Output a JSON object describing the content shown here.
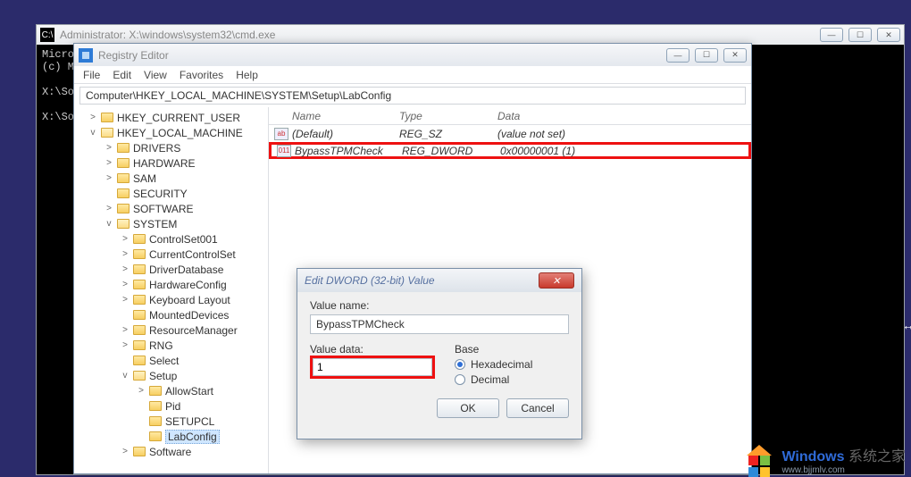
{
  "cmd": {
    "title": "Administrator: X:\\windows\\system32\\cmd.exe",
    "lines": "Micro\n(c) M\n\nX:\\So\n\nX:\\So"
  },
  "regedit": {
    "title": "Registry Editor",
    "menu": [
      "File",
      "Edit",
      "View",
      "Favorites",
      "Help"
    ],
    "path": "Computer\\HKEY_LOCAL_MACHINE\\SYSTEM\\Setup\\LabConfig",
    "tree": [
      {
        "depth": 0,
        "tw": ">",
        "open": false,
        "label": "HKEY_CURRENT_USER"
      },
      {
        "depth": 0,
        "tw": "v",
        "open": true,
        "label": "HKEY_LOCAL_MACHINE"
      },
      {
        "depth": 1,
        "tw": ">",
        "open": false,
        "label": "DRIVERS"
      },
      {
        "depth": 1,
        "tw": ">",
        "open": false,
        "label": "HARDWARE"
      },
      {
        "depth": 1,
        "tw": ">",
        "open": false,
        "label": "SAM"
      },
      {
        "depth": 1,
        "tw": "",
        "open": false,
        "label": "SECURITY"
      },
      {
        "depth": 1,
        "tw": ">",
        "open": false,
        "label": "SOFTWARE"
      },
      {
        "depth": 1,
        "tw": "v",
        "open": true,
        "label": "SYSTEM"
      },
      {
        "depth": 2,
        "tw": ">",
        "open": false,
        "label": "ControlSet001"
      },
      {
        "depth": 2,
        "tw": ">",
        "open": false,
        "label": "CurrentControlSet"
      },
      {
        "depth": 2,
        "tw": ">",
        "open": false,
        "label": "DriverDatabase"
      },
      {
        "depth": 2,
        "tw": ">",
        "open": false,
        "label": "HardwareConfig"
      },
      {
        "depth": 2,
        "tw": ">",
        "open": false,
        "label": "Keyboard Layout"
      },
      {
        "depth": 2,
        "tw": "",
        "open": false,
        "label": "MountedDevices"
      },
      {
        "depth": 2,
        "tw": ">",
        "open": false,
        "label": "ResourceManager"
      },
      {
        "depth": 2,
        "tw": ">",
        "open": false,
        "label": "RNG"
      },
      {
        "depth": 2,
        "tw": "",
        "open": false,
        "label": "Select"
      },
      {
        "depth": 2,
        "tw": "v",
        "open": true,
        "label": "Setup"
      },
      {
        "depth": 3,
        "tw": ">",
        "open": false,
        "label": "AllowStart"
      },
      {
        "depth": 3,
        "tw": "",
        "open": false,
        "label": "Pid"
      },
      {
        "depth": 3,
        "tw": "",
        "open": false,
        "label": "SETUPCL"
      },
      {
        "depth": 3,
        "tw": "",
        "open": false,
        "label": "LabConfig",
        "selected": true
      },
      {
        "depth": 2,
        "tw": ">",
        "open": false,
        "label": "Software"
      }
    ],
    "columns": {
      "name": "Name",
      "type": "Type",
      "data": "Data"
    },
    "values": [
      {
        "icon": "ab",
        "name": "(Default)",
        "type": "REG_SZ",
        "data": "(value not set)",
        "hl": false
      },
      {
        "icon": "011",
        "name": "BypassTPMCheck",
        "type": "REG_DWORD",
        "data": "0x00000001 (1)",
        "hl": true
      }
    ]
  },
  "dialog": {
    "title": "Edit DWORD (32-bit) Value",
    "value_name_label": "Value name:",
    "value_name": "BypassTPMCheck",
    "value_data_label": "Value data:",
    "value_data": "1",
    "base_label": "Base",
    "hex_label": "Hexadecimal",
    "dec_label": "Decimal",
    "ok": "OK",
    "cancel": "Cancel",
    "close_glyph": "✕"
  },
  "watermark": {
    "brand": "Windows",
    "brand_suffix": "系统之家",
    "url": "www.bjjmlv.com"
  }
}
